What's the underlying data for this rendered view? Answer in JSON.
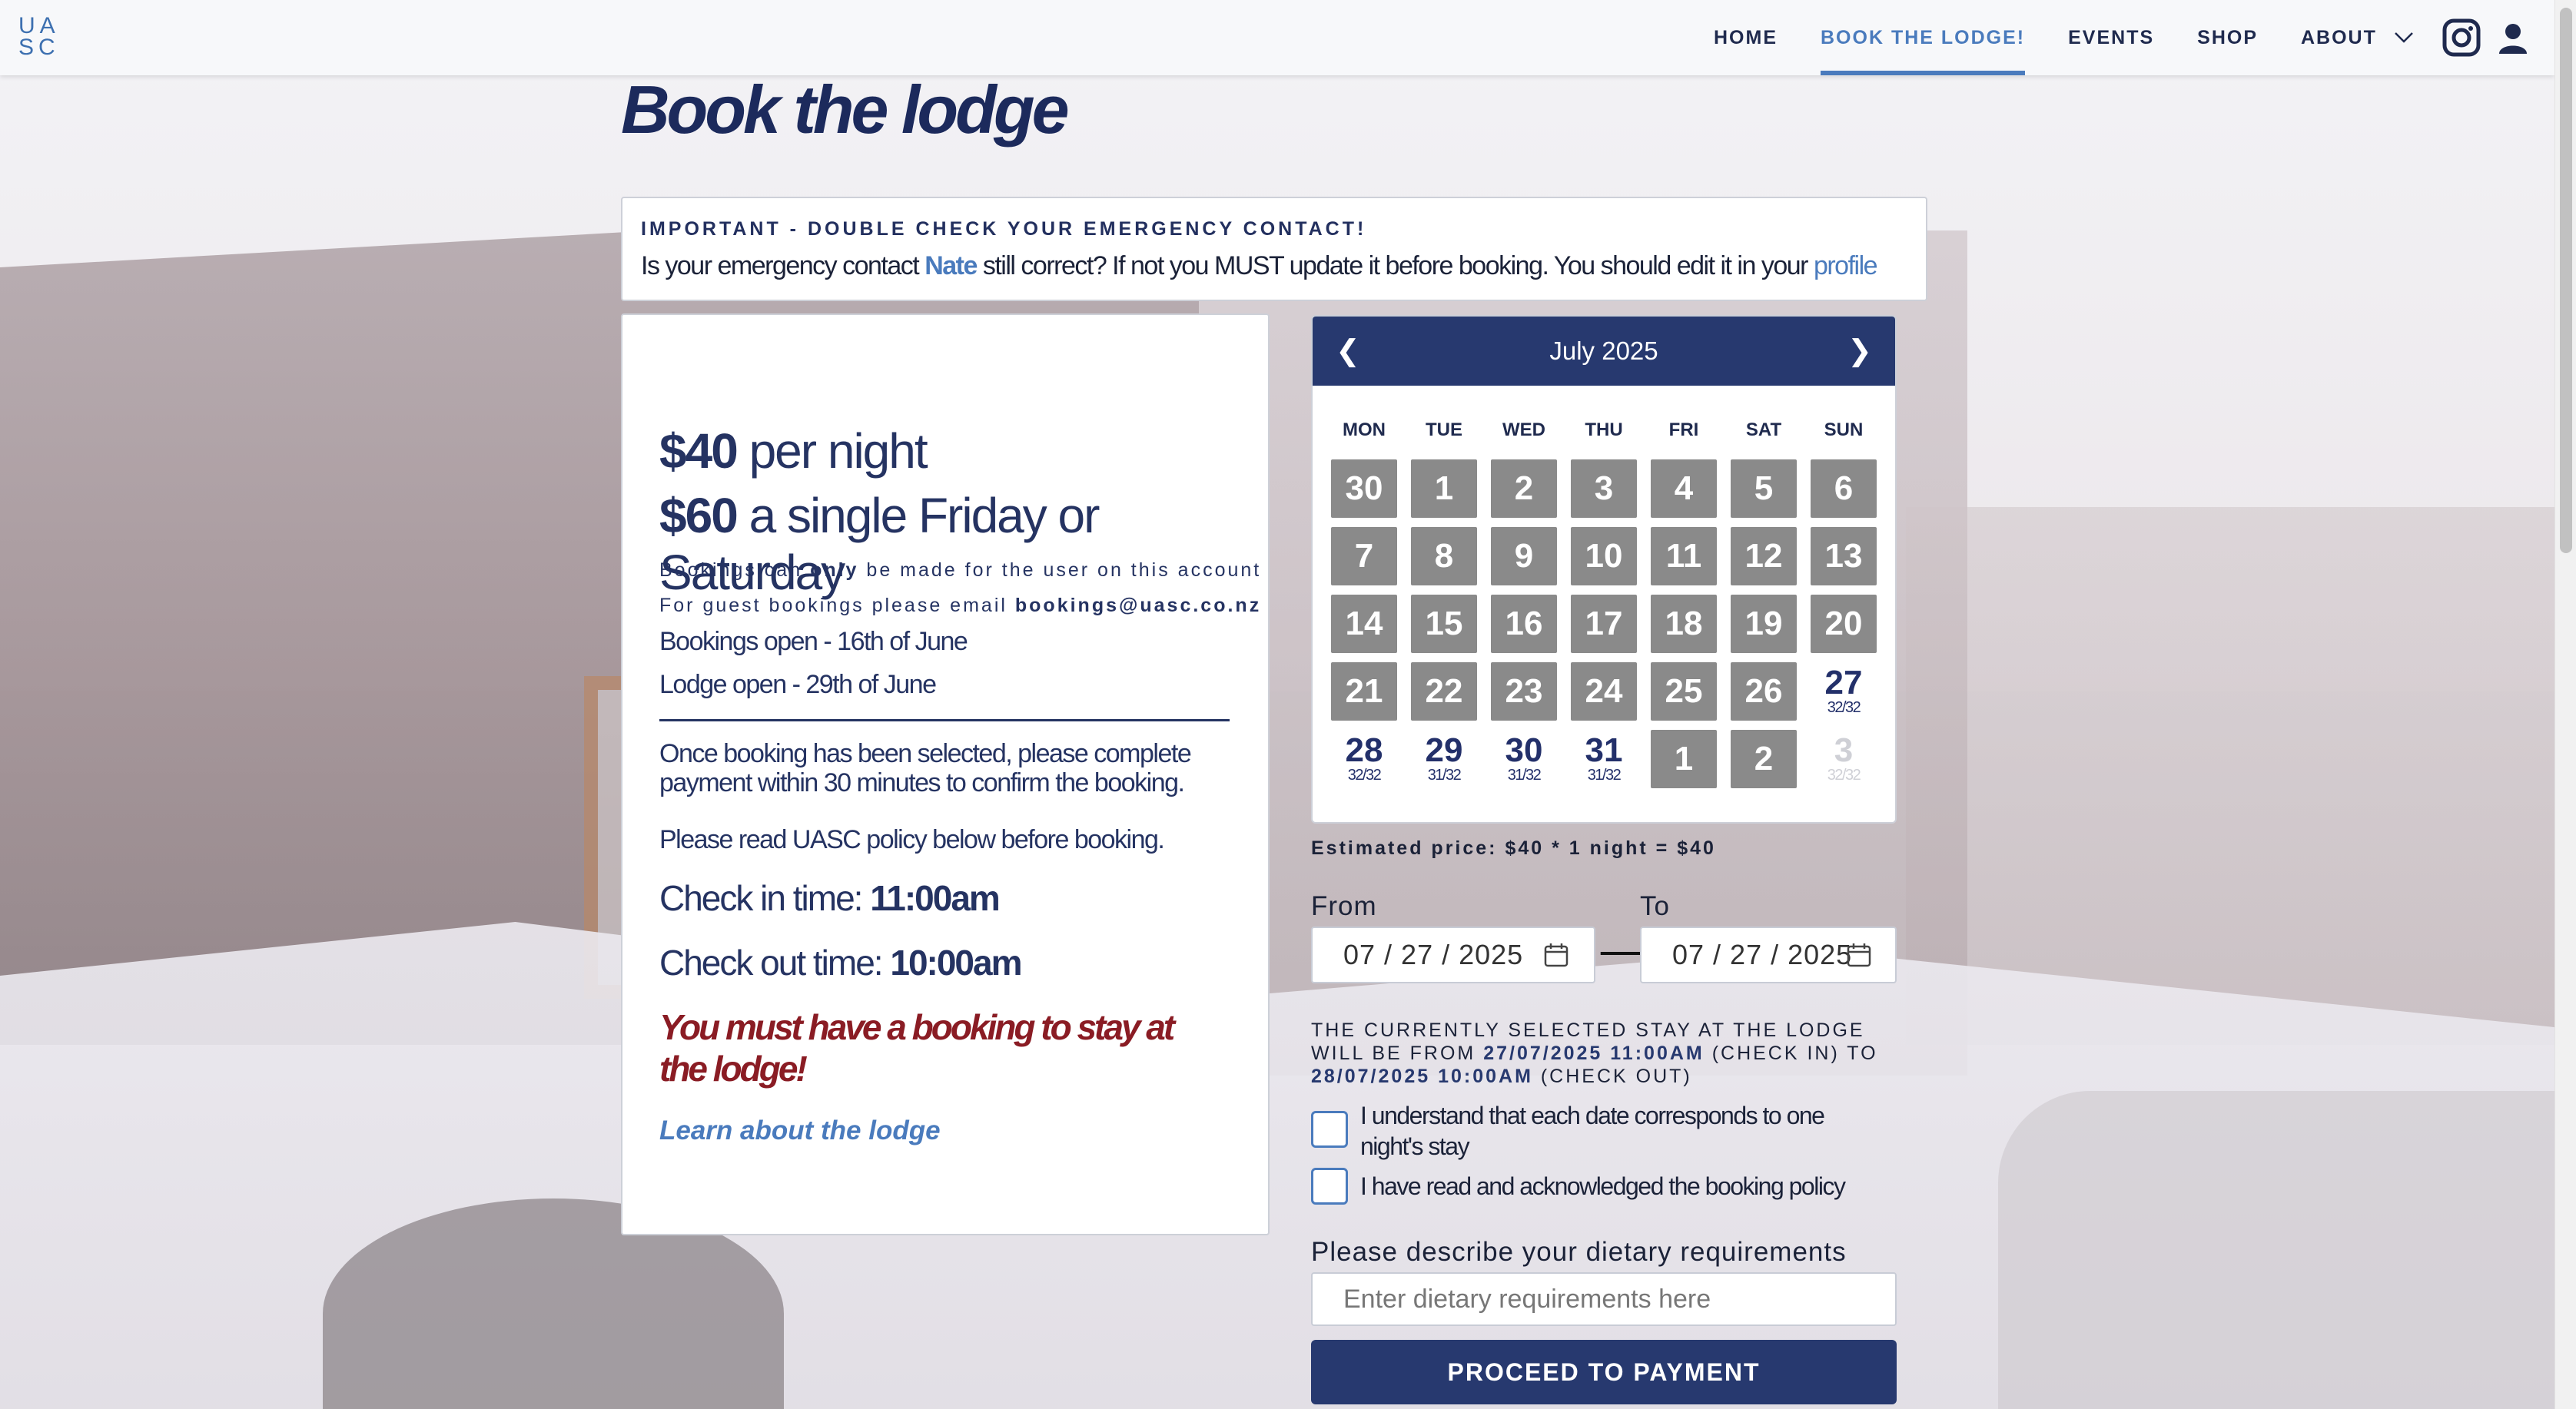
{
  "nav": {
    "logo_text_top": "UA",
    "logo_text_bottom": "SC",
    "links": [
      "HOME",
      "BOOK THE LODGE!",
      "EVENTS",
      "SHOP",
      "ABOUT"
    ],
    "active_index": 1,
    "icons": [
      "instagram-icon",
      "user-icon"
    ],
    "accent": "#4a7bbd"
  },
  "page": {
    "title": "Book the lodge"
  },
  "important": {
    "heading": "IMPORTANT - DOUBLE CHECK YOUR EMERGENCY CONTACT!",
    "body_pre": "Is your emergency contact",
    "contact_name": "Nate",
    "body_post": "still correct? If not you MUST update it before booking. You should edit it in your",
    "profile_link": "profile"
  },
  "info": {
    "price1_amount": "$40",
    "price1_text": "per night",
    "price2_amount": "$60",
    "price2_text": "a single Friday or Saturday",
    "note1_pre": "Bookings can",
    "note1_bold": "only",
    "note1_post": "be made for the user on this account",
    "note2_pre": "For guest bookings please email",
    "note2_email": "bookings@uasc.co.nz",
    "bookings_open": "Bookings open - 16th of June",
    "lodge_open": "Lodge open - 29th of June",
    "payment_note": "Once booking has been selected, please complete payment within 30 minutes to confirm the booking.",
    "policy_note": "Please read UASC policy below before booking.",
    "checkin_label": "Check in time:",
    "checkin_time": "11:00am",
    "checkout_label": "Check out time:",
    "checkout_time": "10:00am",
    "must_book": "You must have a booking to stay at the lodge!",
    "learn_link": "Learn about the lodge"
  },
  "calendar": {
    "prev": "❮",
    "next": "❯",
    "month_label": "July 2025",
    "weekdays": [
      "MON",
      "TUE",
      "WED",
      "THU",
      "FRI",
      "SAT",
      "SUN"
    ],
    "weeks": [
      [
        {
          "n": "30",
          "s": "grey"
        },
        {
          "n": "1",
          "s": "grey"
        },
        {
          "n": "2",
          "s": "grey"
        },
        {
          "n": "3",
          "s": "grey"
        },
        {
          "n": "4",
          "s": "grey"
        },
        {
          "n": "5",
          "s": "grey"
        },
        {
          "n": "6",
          "s": "grey"
        }
      ],
      [
        {
          "n": "7",
          "s": "grey"
        },
        {
          "n": "8",
          "s": "grey"
        },
        {
          "n": "9",
          "s": "grey"
        },
        {
          "n": "10",
          "s": "grey"
        },
        {
          "n": "11",
          "s": "grey"
        },
        {
          "n": "12",
          "s": "grey"
        },
        {
          "n": "13",
          "s": "grey"
        }
      ],
      [
        {
          "n": "14",
          "s": "grey"
        },
        {
          "n": "15",
          "s": "grey"
        },
        {
          "n": "16",
          "s": "grey"
        },
        {
          "n": "17",
          "s": "grey"
        },
        {
          "n": "18",
          "s": "grey"
        },
        {
          "n": "19",
          "s": "grey"
        },
        {
          "n": "20",
          "s": "grey"
        }
      ],
      [
        {
          "n": "21",
          "s": "grey"
        },
        {
          "n": "22",
          "s": "grey"
        },
        {
          "n": "23",
          "s": "grey"
        },
        {
          "n": "24",
          "s": "grey"
        },
        {
          "n": "25",
          "s": "grey"
        },
        {
          "n": "26",
          "s": "grey"
        },
        {
          "n": "27",
          "s": "avail",
          "c": "32/32"
        }
      ],
      [
        {
          "n": "28",
          "s": "avail",
          "c": "32/32"
        },
        {
          "n": "29",
          "s": "avail",
          "c": "31/32"
        },
        {
          "n": "30",
          "s": "avail",
          "c": "31/32"
        },
        {
          "n": "31",
          "s": "avail",
          "c": "31/32"
        },
        {
          "n": "1",
          "s": "grey"
        },
        {
          "n": "2",
          "s": "grey"
        },
        {
          "n": "3",
          "s": "faded",
          "c": "32/32"
        }
      ]
    ]
  },
  "booking": {
    "estimate": "Estimated price: $40 * 1 night = $40",
    "from_label": "From",
    "to_label": "To",
    "from_value": "07 / 27 / 2025",
    "to_value": "07 / 27 / 2025",
    "arrow": "⟶",
    "stay_pre": "THE CURRENTLY SELECTED STAY AT THE LODGE WILL BE FROM",
    "stay_from": "27/07/2025 11:00AM",
    "stay_mid": "(CHECK IN) TO",
    "stay_to": "28/07/2025 10:00AM",
    "stay_post": "(CHECK OUT)",
    "checkbox1": "I understand that each date corresponds to one night's stay",
    "checkbox2": "I have read and acknowledged the booking policy",
    "dietary_label": "Please describe your dietary requirements",
    "dietary_placeholder": "Enter dietary requirements here",
    "proceed": "PROCEED TO PAYMENT"
  }
}
